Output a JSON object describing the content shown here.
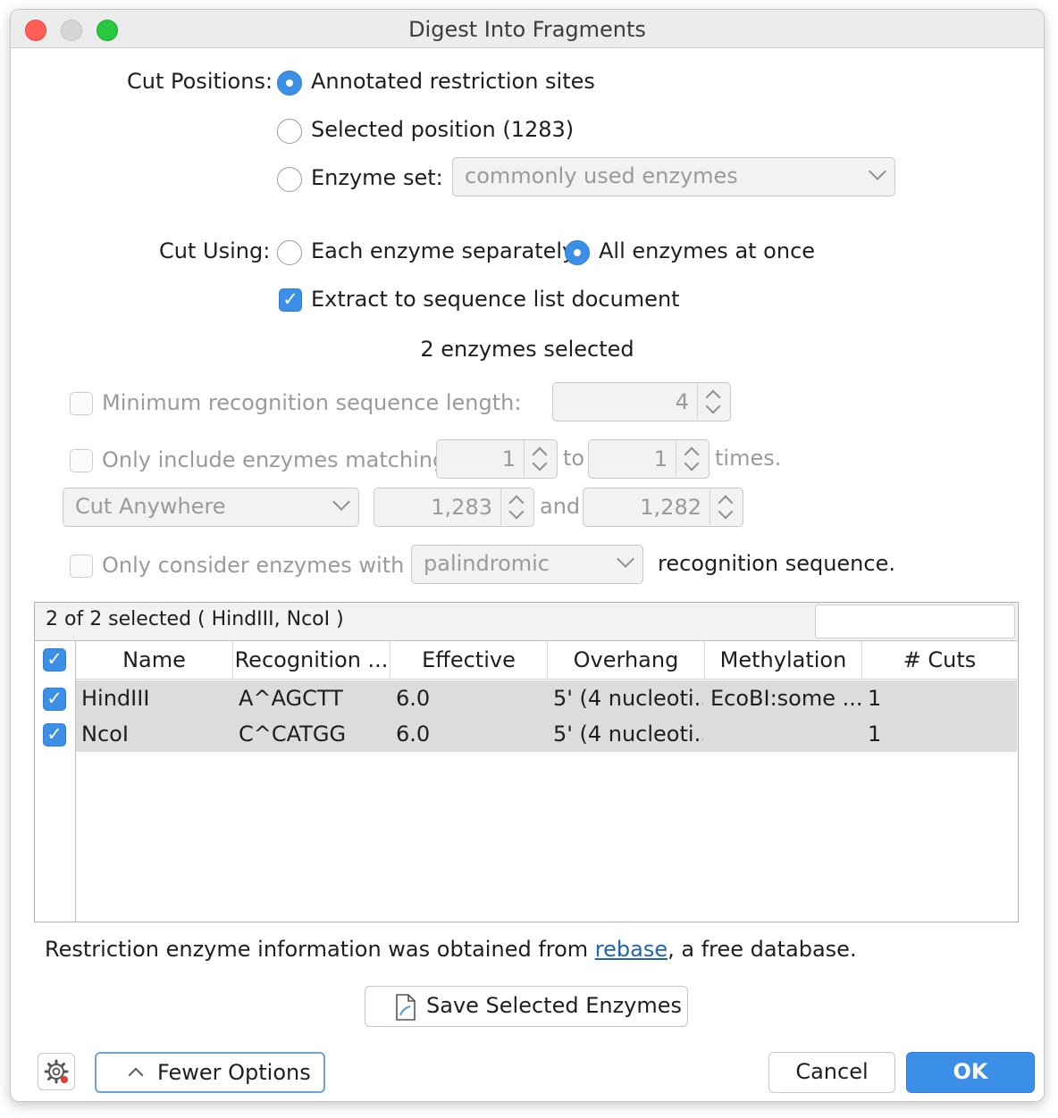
{
  "window": {
    "title": "Digest Into Fragments"
  },
  "cut_positions": {
    "label": "Cut Positions:",
    "options": [
      {
        "label": "Annotated restriction sites",
        "selected": true
      },
      {
        "label": "Selected position (1283)",
        "selected": false
      },
      {
        "label": "Enzyme set:",
        "selected": false
      }
    ],
    "enzyme_set_value": "commonly used enzymes"
  },
  "cut_using": {
    "label": "Cut Using:",
    "options": [
      {
        "label": "Each enzyme separately",
        "selected": false
      },
      {
        "label": "All enzymes at once",
        "selected": true
      }
    ],
    "extract_label": "Extract to sequence list document",
    "extract_checked": true
  },
  "enzymes_selected_text": "2 enzymes selected",
  "filters": {
    "min_length": {
      "label": "Minimum recognition sequence length:",
      "checked": false,
      "value": "4"
    },
    "matching": {
      "label": "Only include enzymes matching",
      "checked": false,
      "from": "1",
      "to_label": "to",
      "to": "1",
      "suffix": "times."
    },
    "cut_range": {
      "mode": "Cut Anywhere",
      "from": "1,283",
      "and_label": "and",
      "to": "1,282"
    },
    "consider": {
      "label": "Only consider enzymes with",
      "checked": false,
      "type": "palindromic",
      "suffix": "recognition sequence."
    }
  },
  "table": {
    "status": "2 of 2 selected ( HindIII, NcoI )",
    "filter_value": "",
    "header_checked": true,
    "columns": [
      "Name",
      "Recognition ...",
      "Effective Len...",
      "Overhang",
      "Methylation",
      "# Cuts"
    ],
    "rows": [
      {
        "checked": true,
        "name": "HindIII",
        "recognition": "A^AGCTT",
        "effective_length": "6.0",
        "overhang": "5' (4 nucleoti...",
        "methylation": "EcoBI:some ...",
        "cuts": "1"
      },
      {
        "checked": true,
        "name": "NcoI",
        "recognition": "C^CATGG",
        "effective_length": "6.0",
        "overhang": "5' (4 nucleoti...",
        "methylation": "",
        "cuts": "1"
      }
    ]
  },
  "info": {
    "prefix": "Restriction enzyme information was obtained from ",
    "link": "rebase",
    "suffix": ", a free database."
  },
  "buttons": {
    "save": "Save Selected Enzymes",
    "fewer": "Fewer Options",
    "cancel": "Cancel",
    "ok": "OK"
  },
  "colors": {
    "accent": "#3b8fe6",
    "link": "#1f64b8",
    "selected_row": "#dcdcdc"
  }
}
